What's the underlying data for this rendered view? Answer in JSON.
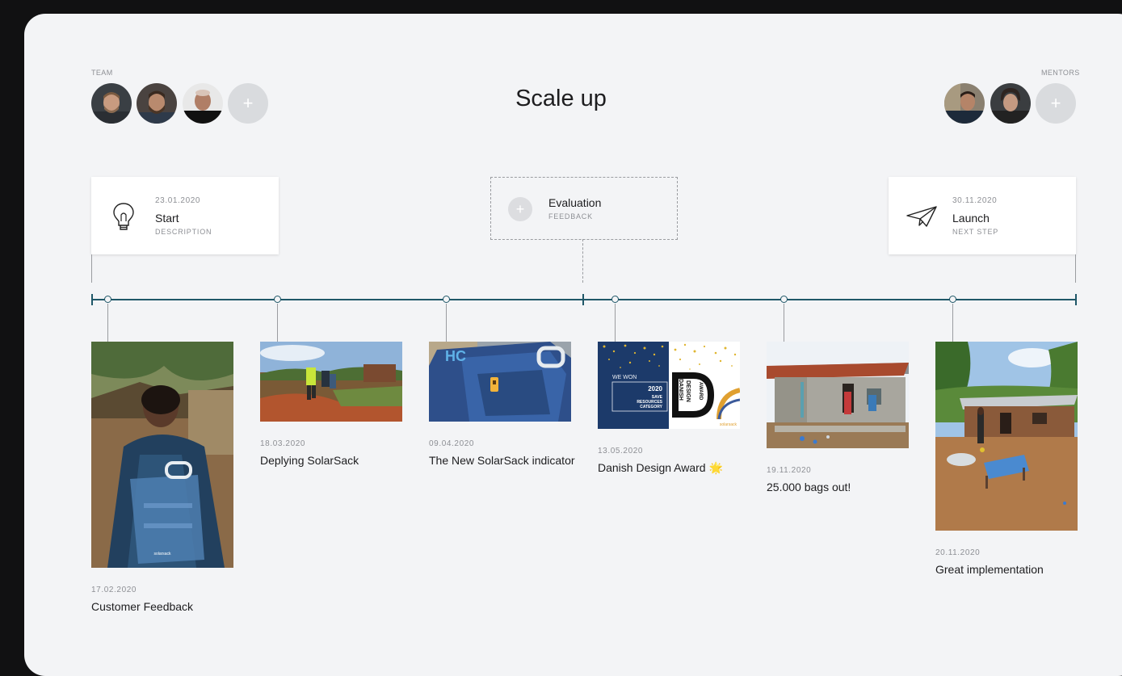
{
  "page": {
    "title": "Scale up"
  },
  "team": {
    "label": "TEAM",
    "members": [
      "avatar-1",
      "avatar-2",
      "avatar-3"
    ],
    "add_symbol": "+"
  },
  "mentors": {
    "label": "MENTORS",
    "members": [
      "avatar-1",
      "avatar-2"
    ],
    "add_symbol": "+"
  },
  "milestones": {
    "start": {
      "date": "23.01.2020",
      "name": "Start",
      "sub": "DESCRIPTION",
      "icon": "lightbulb-icon"
    },
    "evaluation": {
      "name": "Evaluation",
      "sub": "FEEDBACK",
      "add_symbol": "+"
    },
    "launch": {
      "date": "30.11.2020",
      "name": "Launch",
      "sub": "NEXT STEP",
      "icon": "paper-plane-icon"
    }
  },
  "events": [
    {
      "date": "17.02.2020",
      "title": "Customer Feedback"
    },
    {
      "date": "18.03.2020",
      "title": "Deplying SolarSack"
    },
    {
      "date": "09.04.2020",
      "title": "The New SolarSack indicator"
    },
    {
      "date": "13.05.2020",
      "title": "Danish Design Award 🌟"
    },
    {
      "date": "19.11.2020",
      "title": "25.000 bags out!"
    },
    {
      "date": "20.11.2020",
      "title": "Great implementation"
    }
  ],
  "award_image": {
    "we_won": "WE WON",
    "year": "2020",
    "line1": "SAVE",
    "line2": "RESOURCES",
    "line3": "CATEGORY",
    "logo_a": "DANISH",
    "logo_b": "DESIGN",
    "logo_c": "AWARD",
    "brand": "solarsack"
  },
  "photo1_brand": "solarsack",
  "photo3_text": "HC",
  "colors": {
    "accent": "#1f5768",
    "board": "#f3f4f6",
    "background": "#111112"
  }
}
